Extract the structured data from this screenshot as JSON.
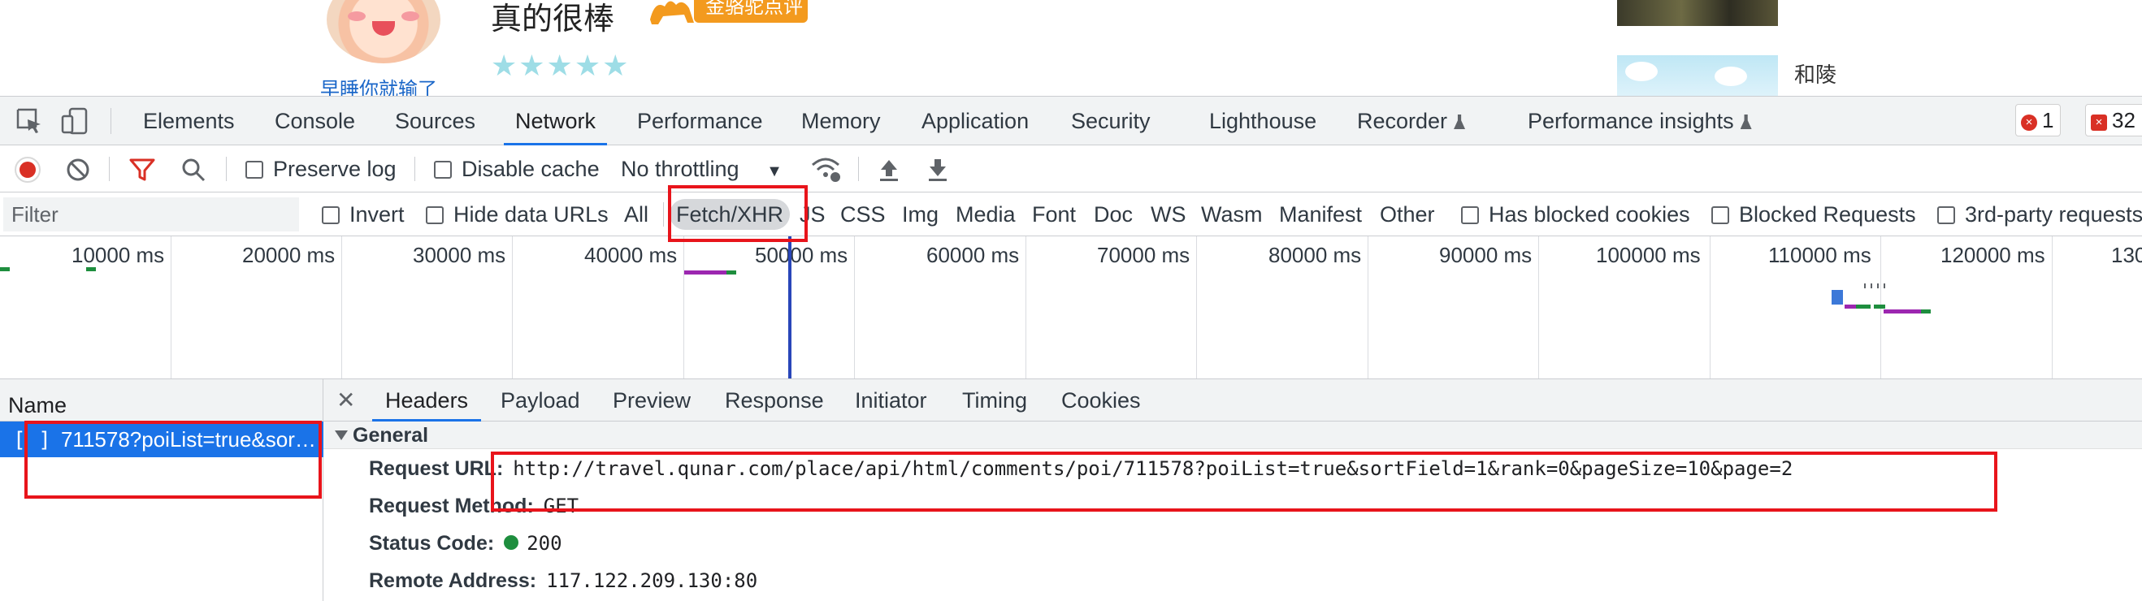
{
  "page": {
    "username": "早睡你就输了",
    "review_title": "真的很棒",
    "badge_text": "金骆驼点评",
    "stars": "★★★★★",
    "place_name": "和陵"
  },
  "devtools": {
    "tabs": [
      {
        "label": "Elements"
      },
      {
        "label": "Console"
      },
      {
        "label": "Sources"
      },
      {
        "label": "Network",
        "active": true
      },
      {
        "label": "Performance"
      },
      {
        "label": "Memory"
      },
      {
        "label": "Application"
      },
      {
        "label": "Security"
      },
      {
        "label": "Lighthouse"
      },
      {
        "label": "Recorder",
        "experimental": true
      },
      {
        "label": "Performance insights",
        "experimental": true
      }
    ],
    "error_count": "1",
    "issue_count": "32",
    "toolbar": {
      "preserve_log": "Preserve log",
      "disable_cache": "Disable cache",
      "throttling": "No throttling"
    },
    "filter": {
      "placeholder": "Filter",
      "invert": "Invert",
      "hide_data_urls": "Hide data URLs",
      "types": [
        "All",
        "Fetch/XHR",
        "JS",
        "CSS",
        "Img",
        "Media",
        "Font",
        "Doc",
        "WS",
        "Wasm",
        "Manifest",
        "Other"
      ],
      "active_type": "Fetch/XHR",
      "has_blocked_cookies": "Has blocked cookies",
      "blocked_requests": "Blocked Requests",
      "third_party": "3rd-party requests"
    },
    "timeline": {
      "ticks": [
        "10000 ms",
        "20000 ms",
        "30000 ms",
        "40000 ms",
        "50000 ms",
        "60000 ms",
        "70000 ms",
        "80000 ms",
        "90000 ms",
        "100000 ms",
        "110000 ms",
        "120000 ms",
        "130"
      ]
    },
    "requests": {
      "header": "Name",
      "rows": [
        {
          "name": "711578?poiList=true&sor…",
          "selected": true
        }
      ]
    },
    "detail_tabs": [
      "Headers",
      "Payload",
      "Preview",
      "Response",
      "Initiator",
      "Timing",
      "Cookies"
    ],
    "active_detail_tab": "Headers",
    "general": {
      "title": "General",
      "request_url_label": "Request URL:",
      "request_url": "http://travel.qunar.com/place/api/html/comments/poi/711578?poiList=true&sortField=1&rank=0&pageSize=10&page=2",
      "request_method_label": "Request Method:",
      "request_method": "GET",
      "status_code_label": "Status Code:",
      "status_code": "200",
      "remote_address_label": "Remote Address:",
      "remote_address": "117.122.209.130:80"
    },
    "colors": {
      "accent": "#1a73e8",
      "highlight_box": "#e8141b",
      "record": "#d93025",
      "status_ok": "#1e8e3e"
    }
  }
}
